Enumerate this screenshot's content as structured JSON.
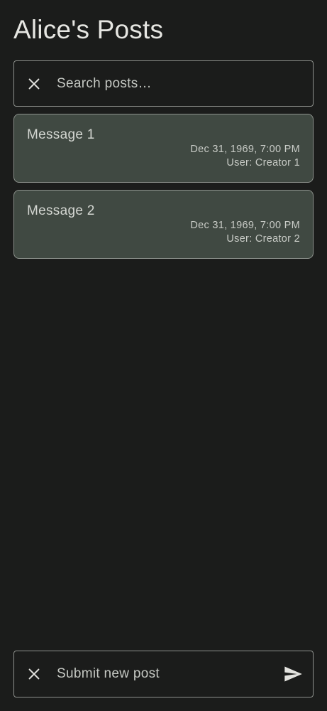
{
  "header": {
    "title": "Alice's Posts"
  },
  "search": {
    "placeholder": "Search posts…",
    "value": "",
    "clear_icon": "close-icon"
  },
  "posts": [
    {
      "message": "Message 1",
      "date": "Dec 31, 1969, 7:00 PM",
      "user": "User: Creator 1"
    },
    {
      "message": "Message 2",
      "date": "Dec 31, 1969, 7:00 PM",
      "user": "User: Creator 2"
    }
  ],
  "composer": {
    "placeholder": "Submit new post",
    "value": "",
    "clear_icon": "close-icon",
    "send_icon": "send-icon"
  },
  "colors": {
    "background": "#1b1c1b",
    "card": "#404942",
    "outline": "#8e918d",
    "text": "#e3e3df"
  }
}
